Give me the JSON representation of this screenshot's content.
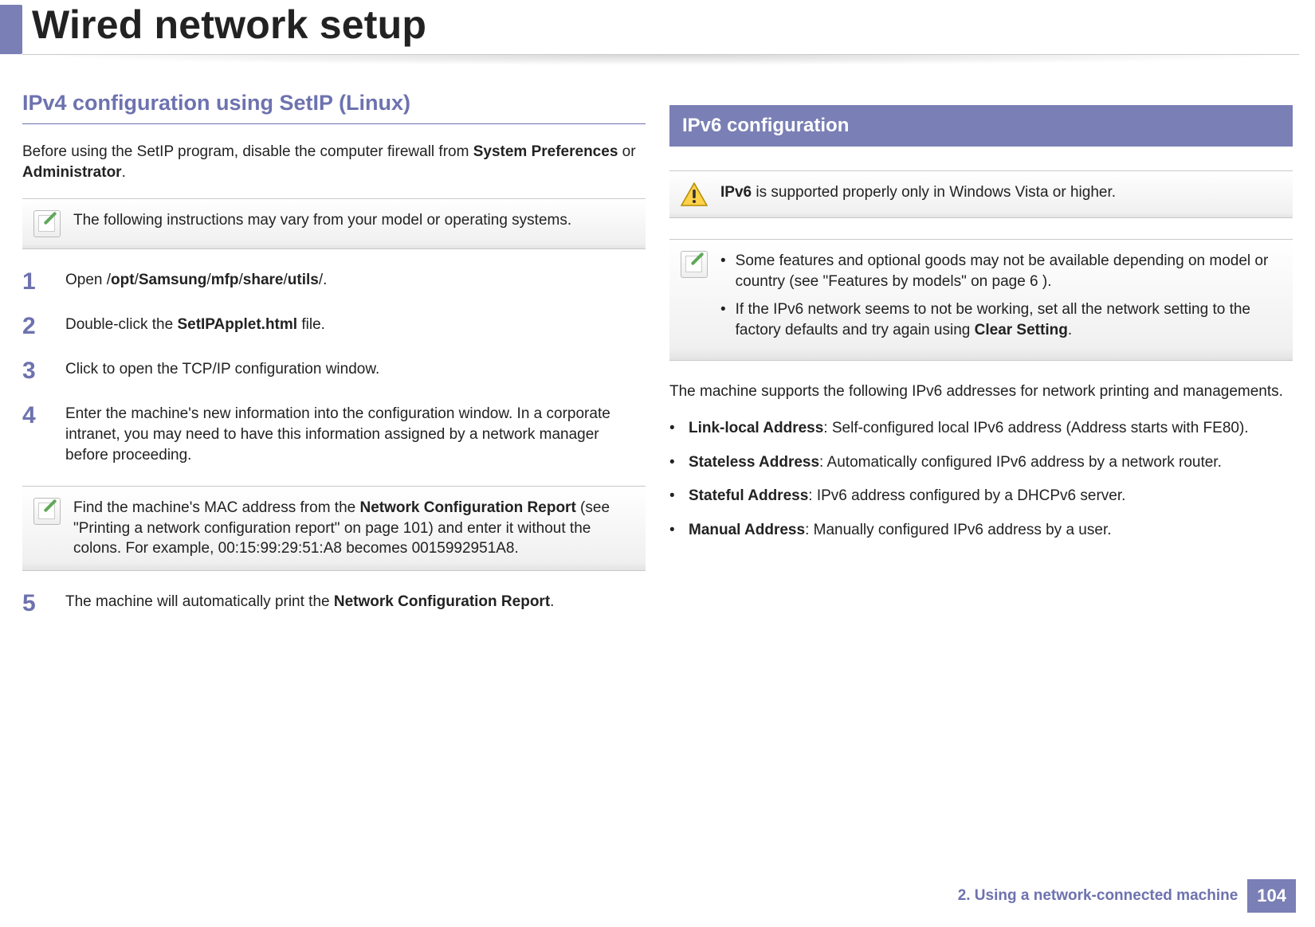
{
  "page": {
    "title": "Wired network setup",
    "footer_chapter": "2.  Using a network-connected machine",
    "page_number": "104"
  },
  "left": {
    "heading": "IPv4 configuration using SetIP (Linux)",
    "intro_a": "Before using the SetIP program, disable the computer firewall from ",
    "intro_b1": "System Preferences",
    "intro_c": " or ",
    "intro_b2": "Administrator",
    "intro_d": ".",
    "note1": "The following instructions may vary from your model or operating systems.",
    "steps": [
      {
        "n": "1",
        "pre": "Open /",
        "b": "opt",
        "s1": "/",
        "b2": "Samsung",
        "s2": "/",
        "b3": "mfp",
        "s3": "/",
        "b4": "share",
        "s4": "/",
        "b5": "utils",
        "post": "/."
      },
      {
        "n": "2",
        "pre": "Double-click the ",
        "b": "SetIPApplet.html",
        "post": " file."
      },
      {
        "n": "3",
        "text": "Click to open the TCP/IP configuration window."
      },
      {
        "n": "4",
        "text": "Enter the machine's new information into the configuration window. In a corporate intranet, you may need to have this information assigned by a network manager before proceeding."
      }
    ],
    "note2_a": "Find the machine's MAC address from the ",
    "note2_b": "Network Configuration Report",
    "note2_c": " (see \"Printing a network configuration report\" on page 101) and enter it without the colons. For example, 00:15:99:29:51:A8 becomes 0015992951A8.",
    "step5_n": "5",
    "step5_a": "The machine will automatically print the ",
    "step5_b": "Network Configuration Report",
    "step5_c": "."
  },
  "right": {
    "banner": "IPv6 configuration",
    "warn_b": "IPv6",
    "warn_rest": " is supported properly only in Windows Vista or higher.",
    "note_items": [
      {
        "a": "Some features and optional goods may not be available depending on model or country (see \"Features by models\" on page 6 )."
      },
      {
        "b_pre": "If the IPv6 network seems to not be working, set all the network setting to the factory defaults and try again using ",
        "b_bold": "Clear Setting",
        "b_post": "."
      }
    ],
    "para": "The machine supports the following IPv6 addresses for network printing and managements.",
    "bullets": [
      {
        "b": "Link-local Address",
        "rest": ": Self-configured local IPv6 address (Address starts with FE80)."
      },
      {
        "b": "Stateless Address",
        "rest": ": Automatically configured IPv6 address by a network router."
      },
      {
        "b": "Stateful Address",
        "rest": ": IPv6 address configured by a DHCPv6 server."
      },
      {
        "b": "Manual Address",
        "rest": ": Manually configured IPv6 address by a user."
      }
    ]
  }
}
